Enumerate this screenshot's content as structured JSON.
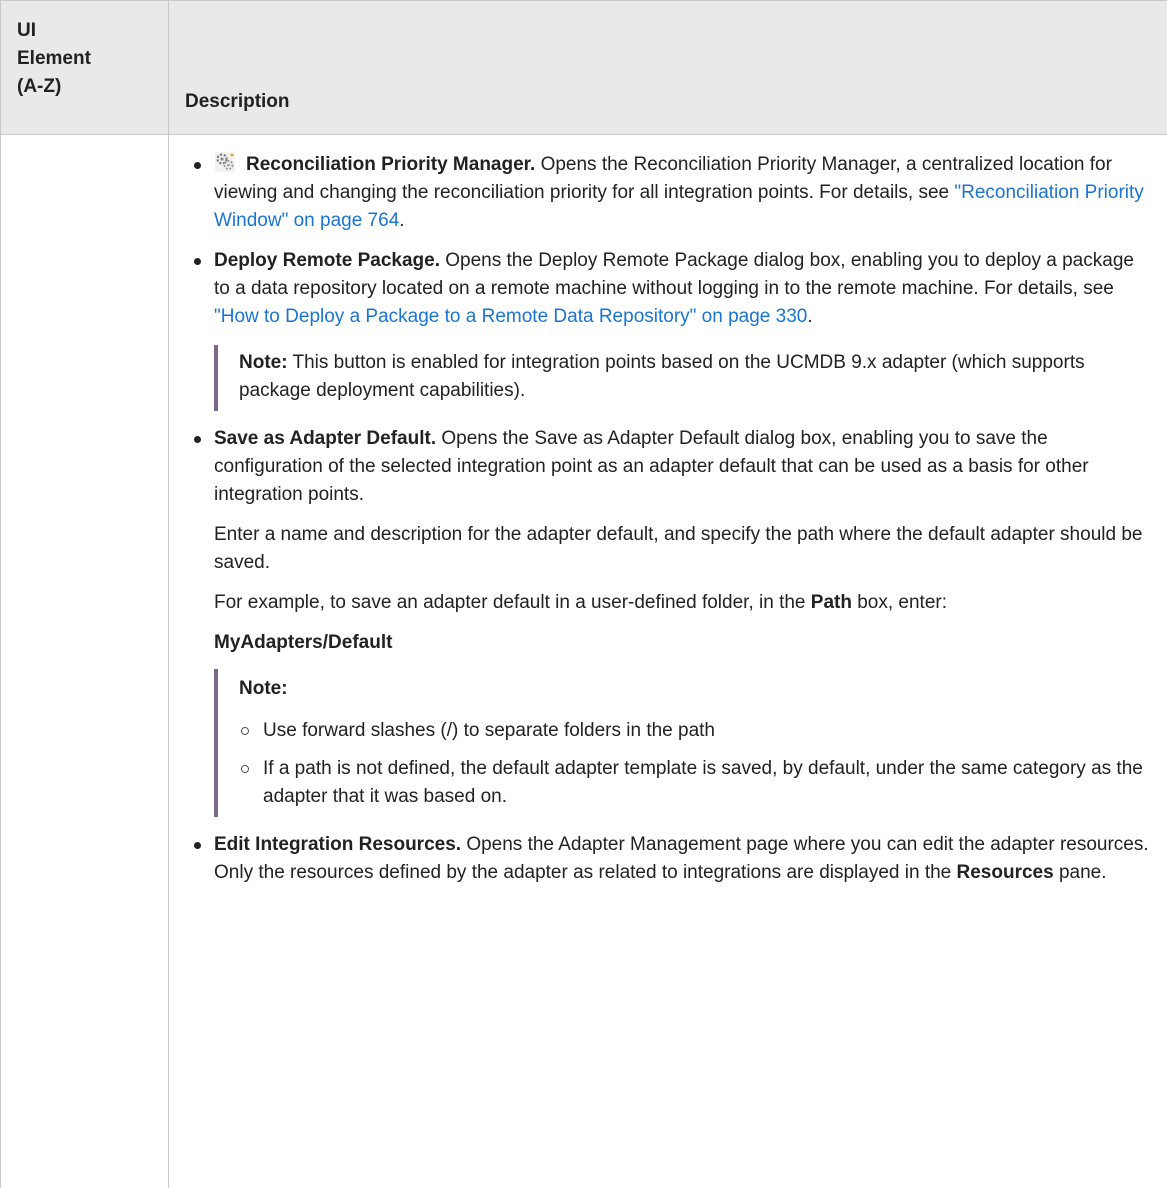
{
  "header": {
    "ui_element_line1": "UI",
    "ui_element_line2": "Element",
    "ui_element_line3": "(A-Z)",
    "description": "Description"
  },
  "items": {
    "reconciliation": {
      "icon": "reconciliation-priority-icon",
      "title": "Reconciliation Priority Manager.",
      "text": " Opens the Reconciliation Priority Manager, a centralized location for viewing and changing the reconciliation priority for all integration points. For details, see ",
      "link": "\"Reconciliation Priority Window\" on page 764",
      "end": "."
    },
    "deploy": {
      "title": "Deploy Remote Package.",
      "text": " Opens the Deploy Remote Package dialog box, enabling you to deploy a package to a data repository located on a remote machine without logging in to the remote machine. For details, see ",
      "link": "\"How to Deploy a Package to a Remote Data Repository\" on page 330",
      "end": ".",
      "note_label": "Note:",
      "note_text": " This button is enabled for integration points based on the UCMDB 9.x adapter (which supports package deployment capabilities)."
    },
    "save_default": {
      "title": "Save as Adapter Default.",
      "text": " Opens the Save as Adapter Default dialog box, enabling you to save the configuration of the selected integration point as an adapter default that can be used as a basis for other integration points.",
      "para2": "Enter a name and description for the adapter default, and specify the path where the default adapter should be saved.",
      "para3_a": "For example, to save an adapter default in a user-defined folder, in the ",
      "para3_bold": "Path",
      "para3_b": " box, enter:",
      "example_path": "MyAdapters/Default",
      "note_label": "Note:",
      "note_items": [
        "Use forward slashes (/) to separate folders in the path",
        "If a path is not defined, the default adapter template is saved, by default, under the same category as the adapter that it was based on."
      ]
    },
    "edit_resources": {
      "title": "Edit Integration Resources.",
      "text": " Opens the Adapter Management page where you can edit the adapter resources. Only the resources defined by the adapter as related to integrations are displayed in the ",
      "bold_end": "Resources",
      "end": " pane."
    }
  }
}
